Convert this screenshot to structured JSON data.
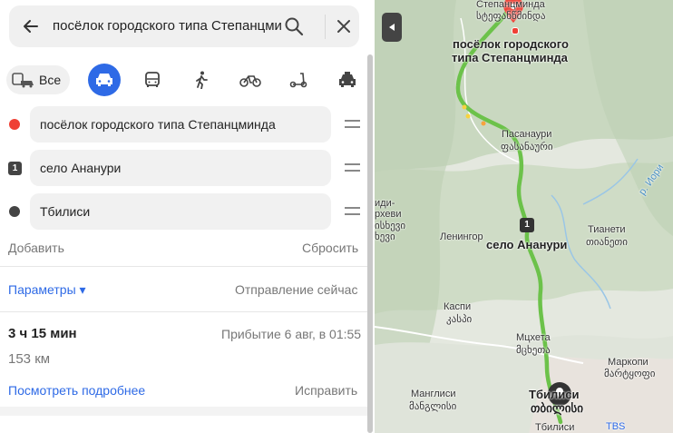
{
  "search": {
    "query": "посёлок городского типа Степанцминда"
  },
  "modes": {
    "all_label": "Все"
  },
  "route_points": [
    {
      "label": "посёлок городского типа Степанцминда",
      "marker": "red-dot"
    },
    {
      "label": "село Ананури",
      "marker": "1"
    },
    {
      "label": "Тбилиси",
      "marker": "dark-dot"
    }
  ],
  "actions": {
    "add": "Добавить",
    "reset": "Сбросить"
  },
  "params": {
    "label": "Параметры ▾",
    "departure": "Отправление сейчас"
  },
  "route": {
    "duration": "3 ч 15 мин",
    "arrival": "Прибытие 6 авг, в 01:55",
    "distance": "153 км",
    "details": "Посмотреть подробнее",
    "fix": "Исправить"
  },
  "map": {
    "labels": {
      "stepants_top": "Степанцминда",
      "stepants_top_geo": "სტეფანწმინდა",
      "stepants_1": "посёлок городского",
      "stepants_2": "типа Степанцминда",
      "pasanauri": "Пасанаури",
      "pasanauri_geo": "ფასანაური",
      "khevi": "иди-",
      "khevi2": "рхеви",
      "khevi_geo": "ისხევი",
      "khevi_geo2": "ხევი",
      "aragvi": "р. Иори",
      "tianeti": "Тианети",
      "tianeti_geo": "თიანეთი",
      "leningor": "Ленингор",
      "ananuri_num": "1",
      "ananuri": "село Ананури",
      "kaspi": "Каспи",
      "kaspi_geo": "კასპი",
      "mtskheta": "Мцхета",
      "mtskheta_geo": "მცხეთა",
      "martkopi": "Маркопи",
      "martkopi_geo": "მარტყოფი",
      "manglisi": "Манглиси",
      "manglisi_geo": "მანგლისი",
      "tbilisi": "Тбилиси",
      "tbilisi_geo": "თბილისი",
      "tbilisi_bottom": "Тбилиси",
      "tbs": "TBS"
    },
    "route_color": "#6cc24a",
    "start_pin_color": "#ef4035"
  }
}
